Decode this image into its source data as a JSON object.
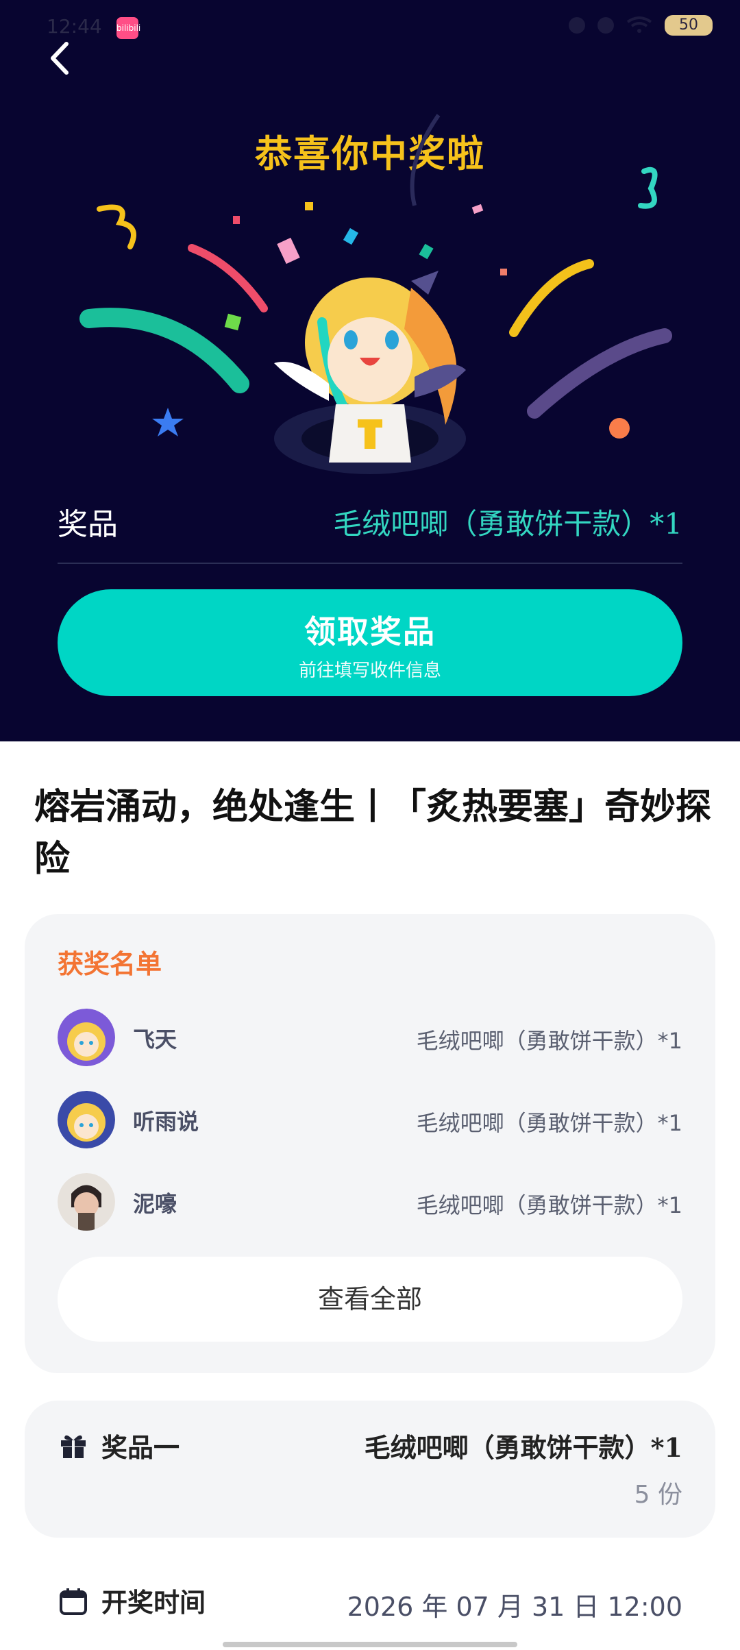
{
  "status": {
    "time": "12:44",
    "battery": "50",
    "app_badge": "bilibili"
  },
  "header": {
    "congrats": "恭喜你中奖啦"
  },
  "prize": {
    "label": "奖品",
    "value": "毛绒吧唧（勇敢饼干款）*1"
  },
  "claim_button": {
    "title": "领取奖品",
    "subtitle": "前往填写收件信息"
  },
  "event": {
    "title": "熔岩涌动，绝处逢生丨「炙热要塞」奇妙探险"
  },
  "winners": {
    "title": "获奖名单",
    "rows": [
      {
        "name": "飞天",
        "prize": "毛绒吧唧（勇敢饼干款）*1"
      },
      {
        "name": "听雨说",
        "prize": "毛绒吧唧（勇敢饼干款）*1"
      },
      {
        "name": "泥嚎",
        "prize": "毛绒吧唧（勇敢饼干款）*1"
      }
    ],
    "view_all": "查看全部"
  },
  "prize_one": {
    "label": "奖品一",
    "value": "毛绒吧唧（勇敢饼干款）*1",
    "count": "5 份"
  },
  "draw_time": {
    "label": "开奖时间",
    "value": "2026 年 07 月 31 日 12:00"
  },
  "colors": {
    "hero_bg": "#080530",
    "accent": "#00d6c5",
    "congrats": "#f6c21b",
    "winners_title": "#f37433"
  }
}
